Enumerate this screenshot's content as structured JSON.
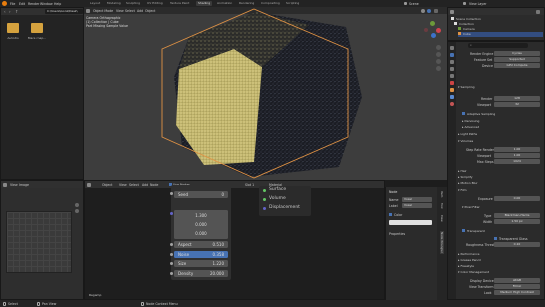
{
  "menu": [
    "File",
    "Edit",
    "Render",
    "Window",
    "Help"
  ],
  "workspaces": [
    "Layout",
    "Modeling",
    "Sculpting",
    "UV Editing",
    "Texture Paint",
    "Shading",
    "Animation",
    "Rendering",
    "Compositing",
    "Scripting"
  ],
  "active_workspace": "Shading",
  "scene": "Scene",
  "view_layer": "View Layer",
  "file_browser": {
    "path": "C:\\Users\\Gonz\\Desk\\",
    "folders": [
      "Autodis",
      "Macs rnap..."
    ]
  },
  "viewport": {
    "mode": "Object Mode",
    "menu": [
      "View",
      "Select",
      "Add",
      "Object"
    ],
    "overlay_lines": [
      "Camera Orthographic",
      "(1) Collection | Cube",
      "Part Missing Sample Value"
    ]
  },
  "outliner": {
    "title": "Scene Collection",
    "items": [
      "Collection",
      "Camera",
      "Cube"
    ]
  },
  "properties": {
    "render_engine_label": "Render Engine",
    "render_engine": "Cycles",
    "feature_set_label": "Feature Set",
    "feature_set": "Supported",
    "device_label": "Device",
    "device": "GPU Compute",
    "sampling": "Sampling",
    "render_label": "Render",
    "render_value": "128",
    "viewport_label": "Viewport",
    "viewport_value": "32",
    "adaptive_sampling": "Adaptive Sampling",
    "denoising": "Denoising",
    "advanced": "Advanced",
    "light_paths": "Light Paths",
    "volumes": "Volumes",
    "step_rate_render_label": "Step Rate Render",
    "step_rate_render": "1.00",
    "step_viewport_label": "Viewport",
    "step_viewport": "1.00",
    "max_steps_label": "Max Steps",
    "max_steps": "1024",
    "hair": "Hair",
    "simplify": "Simplify",
    "motion_blur": "Motion Blur",
    "film": "Film",
    "exposure_label": "Exposure",
    "exposure": "0.00",
    "pixel_filter": "Pixel Filter",
    "filter_type_label": "Type",
    "filter_type": "Blackman-Harris",
    "filter_width_label": "Width",
    "filter_width": "1.50 px",
    "transparent": "Transparent",
    "transparent_glass": "Transparent Glass",
    "roughness_threshold_label": "Roughness Threshold",
    "roughness_threshold": "0.10",
    "performance": "Performance",
    "grease_pencil": "Grease Pencil",
    "freestyle": "Freestyle",
    "color_management": "Color Management",
    "display_device_label": "Display Device",
    "display_device": "sRGB",
    "view_transform_label": "View Transform",
    "view_transform": "Filmic",
    "look_label": "Look",
    "look": "Medium High Contrast"
  },
  "node_editor": {
    "header": [
      "Object",
      "View",
      "Select",
      "Add",
      "Node"
    ],
    "use_nodes": "Use Nodes",
    "slot": "Slot 1",
    "material": "Material",
    "footer": "Regamp",
    "noise_node": {
      "seed_label": "Seed",
      "seed": "0",
      "values": [
        "1.300",
        "0.000",
        "0.000"
      ],
      "aspect_label": "Aspect",
      "aspect": "0.510",
      "noise_label": "Noise",
      "noise": "0.358",
      "size_label": "Size",
      "size": "1.220",
      "density_label": "Density",
      "density": "20.000"
    },
    "output_node": {
      "surface": "Surface",
      "volume": "Volume",
      "displacement": "Displacement"
    },
    "sidebar": {
      "node_title": "Node",
      "name_label": "Name",
      "name_value": "Voxel",
      "label_label": "Label",
      "label_value": "Voxel",
      "color": "Color",
      "properties": "Properties",
      "tabs": [
        "Item",
        "Tool",
        "View",
        "Node Wrangler"
      ]
    }
  },
  "image_editor": {
    "header": [
      "View",
      "Image"
    ]
  },
  "status_bar": {
    "left": "Select",
    "middle": "Pan View",
    "right": "Node Context Menu"
  },
  "colors": {
    "accent": "#e09244",
    "selected_blue": "#4772b3",
    "socket_green": "#63c763",
    "socket_purple": "#6363c7",
    "socket_grey": "#a1a1a1"
  }
}
